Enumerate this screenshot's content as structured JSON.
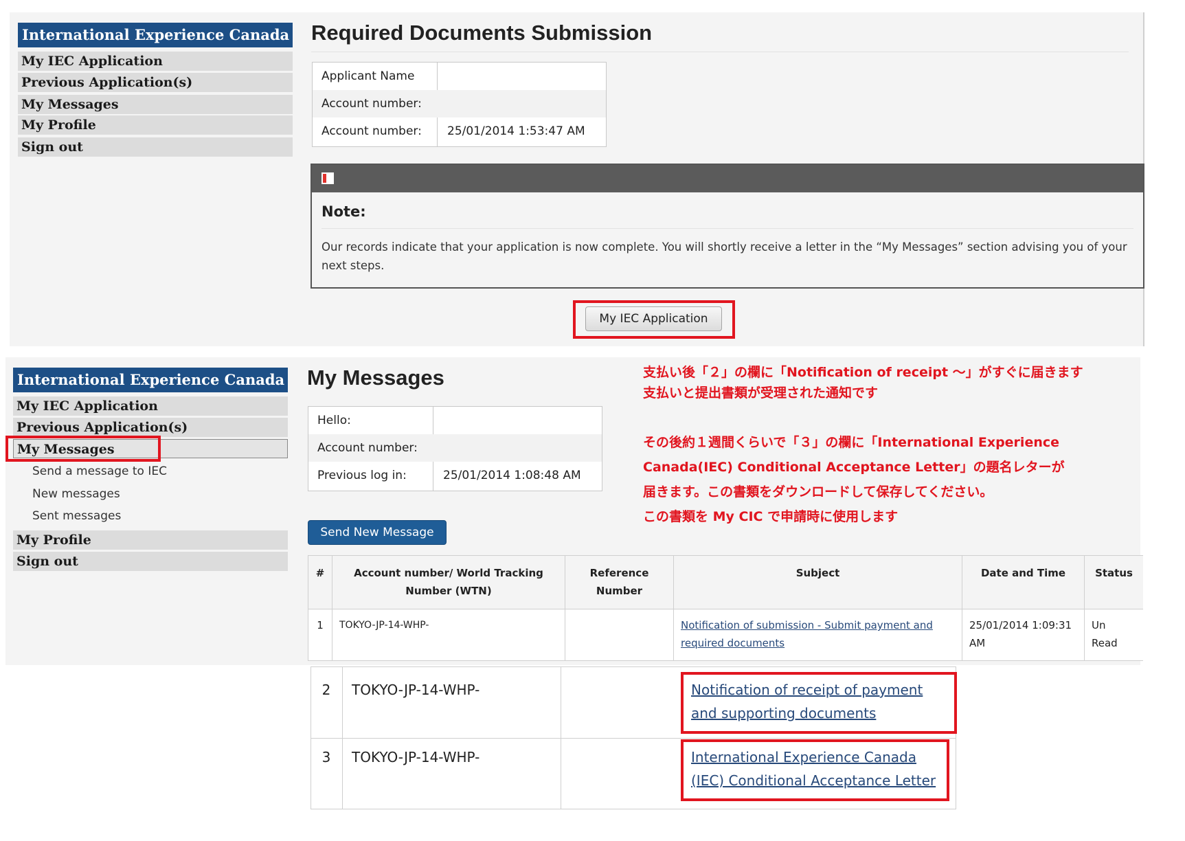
{
  "top": {
    "sidebar": {
      "title": "International Experience Canada",
      "items": [
        "My IEC Application",
        "Previous Application(s)",
        "My Messages",
        "My Profile",
        "Sign out"
      ]
    },
    "page_title": "Required Documents Submission",
    "info": [
      {
        "label": "Applicant Name",
        "value": ""
      },
      {
        "label": "Account number:",
        "value": ""
      },
      {
        "label": "Account number:",
        "value": "25/01/2014 1:53:47 AM"
      }
    ],
    "note": {
      "heading": "Note:",
      "body": "Our records indicate that your application is now complete. You will shortly receive a letter in the “My Messages” section advising you of your next steps.",
      "icon": "book-icon"
    },
    "button_label": "My IEC Application"
  },
  "bottom": {
    "sidebar": {
      "title": "International Experience Canada",
      "items": [
        "My IEC Application",
        "Previous Application(s)",
        "My Messages",
        "My Profile",
        "Sign out"
      ],
      "sub_items": [
        "Send a message to IEC",
        "New messages",
        "Sent messages"
      ]
    },
    "page_title": "My Messages",
    "info": [
      {
        "label": "Hello:",
        "value": ""
      },
      {
        "label": "Account number:",
        "value": ""
      },
      {
        "label": "Previous log in:",
        "value": "25/01/2014 1:08:48 AM"
      }
    ],
    "send_button": "Send New Message",
    "table": {
      "headers": [
        "#",
        "Account number/ World Tracking Number (WTN)",
        "Reference Number",
        "Subject",
        "Date and Time",
        "Status"
      ],
      "rows": [
        {
          "num": "1",
          "account": "TOKYO-JP-14-WHP-",
          "reference": "",
          "subject": "Notification of submission - Submit payment and required documents",
          "datetime": "25/01/2014 1:09:31 AM",
          "status": "Un Read"
        },
        {
          "num": "2",
          "account": "TOKYO-JP-14-WHP-",
          "reference": "",
          "subject": "Notification of receipt of payment and supporting documents"
        },
        {
          "num": "3",
          "account": "TOKYO-JP-14-WHP-",
          "reference": "",
          "subject": "International Experience Canada (IEC) Conditional Acceptance Letter"
        }
      ]
    }
  },
  "annotation": {
    "lines": [
      "支払い後「２」の欄に「Notification of receipt ～」がすぐに届きます",
      "支払いと提出書類が受理された通知です",
      "その後約１週間くらいで「３」の欄に「International Experience",
      "Canada(IEC) Conditional Acceptance Letter」の題名レターが",
      "届きます。この書類をダウンロードして保存してください。",
      "この書類を My CIC で申請時に使用します"
    ],
    "color": "#e1151f"
  },
  "colors": {
    "sidebar_title": "#1d4f86",
    "send_button": "#1f5d97",
    "highlight": "#e1151f",
    "link": "#27497a"
  }
}
